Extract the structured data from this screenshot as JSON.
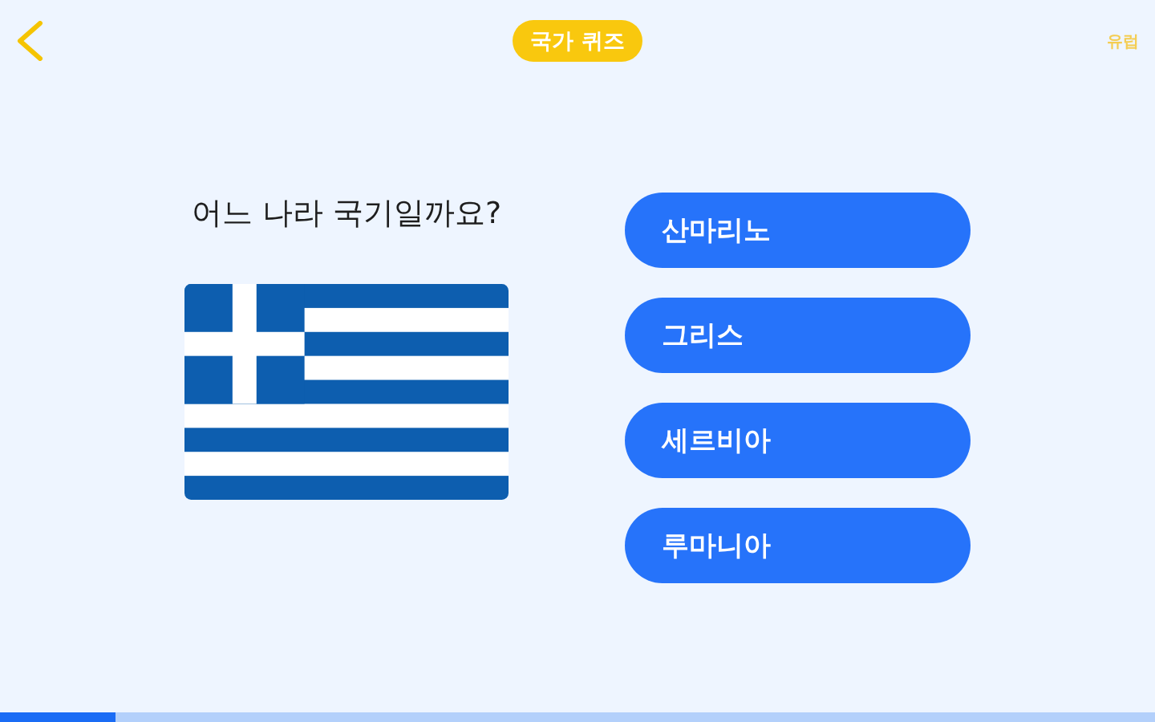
{
  "header": {
    "title": "국가 퀴즈",
    "category": "유럽"
  },
  "question": {
    "prompt": "어느 나라 국기일까요?"
  },
  "answers": [
    "산마리노",
    "그리스",
    "세르비아",
    "루마니아"
  ],
  "progress": {
    "level": 0.1
  }
}
